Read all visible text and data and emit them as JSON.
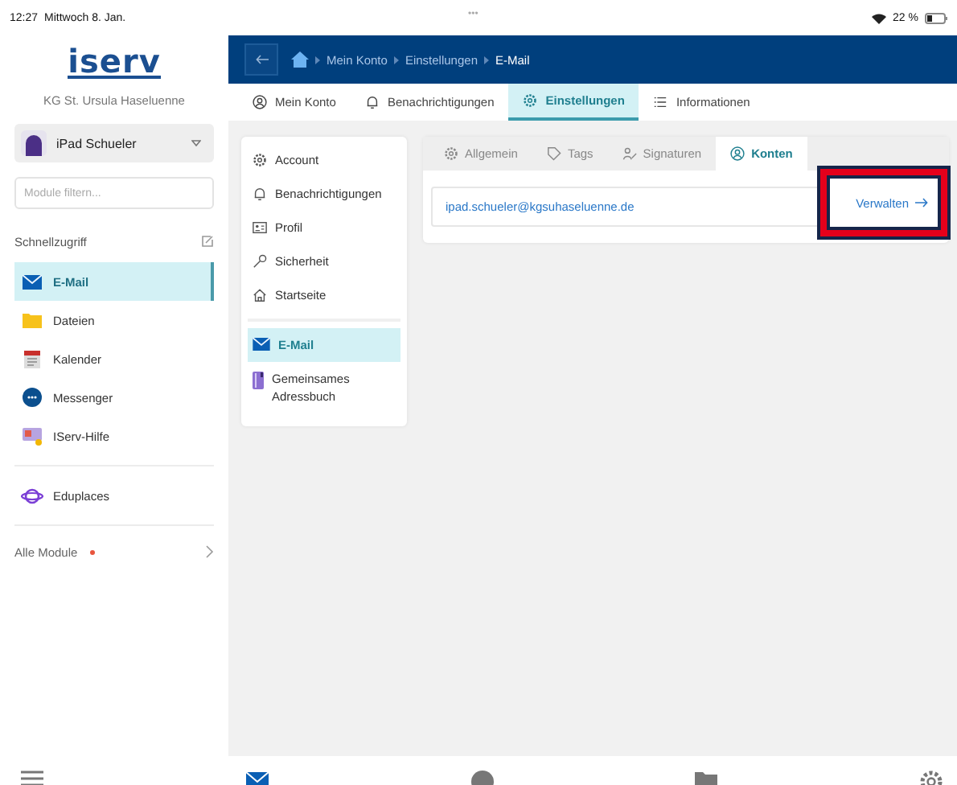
{
  "status_bar": {
    "time": "12:27",
    "date": "Mittwoch 8. Jan.",
    "dots": "•••",
    "battery": "22 %"
  },
  "sidebar": {
    "logo": "iserv",
    "school": "KG St. Ursula Haseluenne",
    "user": "iPad Schueler",
    "filter": {
      "placeholder": "Module filtern..."
    },
    "quick_access_label": "Schnellzugriff",
    "items": [
      {
        "label": "E-Mail",
        "kind": "mail",
        "selected": true
      },
      {
        "label": "Dateien",
        "kind": "folder",
        "selected": false
      },
      {
        "label": "Kalender",
        "kind": "calendar",
        "selected": false
      },
      {
        "label": "Messenger",
        "kind": "chat",
        "selected": false
      },
      {
        "label": "IServ-Hilfe",
        "kind": "help",
        "selected": false
      }
    ],
    "extra": [
      {
        "label": "Eduplaces",
        "kind": "planet",
        "selected": false
      }
    ],
    "all_modules": {
      "label": "Alle Module",
      "notification": true
    }
  },
  "header": {
    "breadcrumb": [
      "Mein Konto",
      "Einstellungen",
      "E-Mail"
    ]
  },
  "tabs": [
    {
      "label": "Mein Konto",
      "kind": "user",
      "selected": false
    },
    {
      "label": "Benachrichtigungen",
      "kind": "bell",
      "selected": false
    },
    {
      "label": "Einstellungen",
      "kind": "gear",
      "selected": true
    },
    {
      "label": "Informationen",
      "kind": "list",
      "selected": false
    }
  ],
  "settings_nav": {
    "items": [
      {
        "label": "Account",
        "kind": "gear",
        "selected": false
      },
      {
        "label": "Benachrichtigungen",
        "kind": "bell",
        "selected": false
      },
      {
        "label": "Profil",
        "kind": "card",
        "selected": false
      },
      {
        "label": "Sicherheit",
        "kind": "key",
        "selected": false
      },
      {
        "label": "Startseite",
        "kind": "home",
        "selected": false
      }
    ],
    "modules": [
      {
        "label": "E-Mail",
        "kind": "mail",
        "selected": true
      },
      {
        "label": "Gemeinsames Adressbuch",
        "kind": "book",
        "selected": false
      }
    ]
  },
  "mail_tabs": [
    {
      "label": "Allgemein",
      "kind": "gear",
      "selected": false
    },
    {
      "label": "Tags",
      "kind": "tag",
      "selected": false
    },
    {
      "label": "Signaturen",
      "kind": "sign",
      "selected": false
    },
    {
      "label": "Konten",
      "kind": "user",
      "selected": true
    }
  ],
  "accounts": [
    {
      "email": "ipad.schueler@kgsuhaseluenne.de",
      "action": "Verwalten",
      "highlighted": true
    }
  ],
  "bottom_bar": [
    {
      "kind": "menu",
      "selected": false
    },
    {
      "kind": "mail",
      "selected": true
    },
    {
      "kind": "chat",
      "selected": false
    },
    {
      "kind": "folder",
      "selected": false
    },
    {
      "kind": "gear",
      "selected": false
    }
  ]
}
